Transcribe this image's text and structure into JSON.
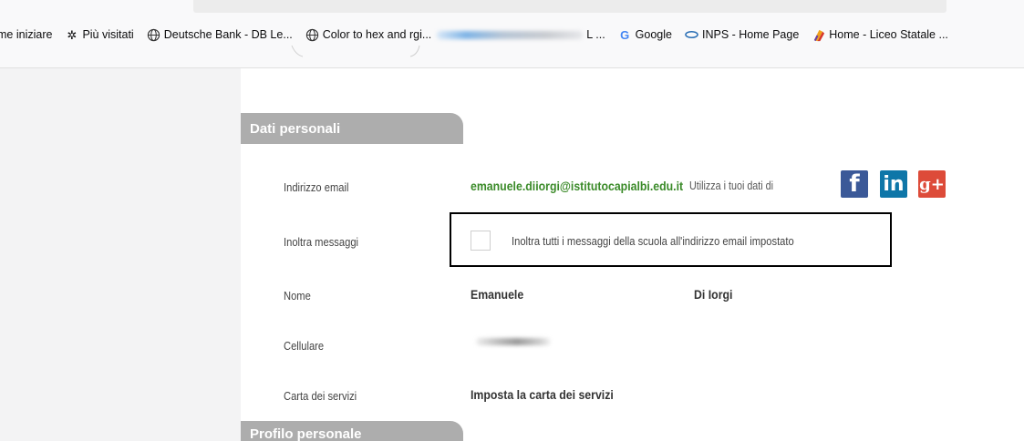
{
  "bookmarks": {
    "items": [
      {
        "label": "me iniziare",
        "icon": ""
      },
      {
        "label": "Più visitati",
        "icon": "gear-icon"
      },
      {
        "label": "Deutsche Bank - DB Le...",
        "icon": "globe-icon"
      },
      {
        "label": "Color to hex and rgi...",
        "icon": "globe-icon"
      },
      {
        "label": "L ...",
        "icon": "blurred-favicon"
      },
      {
        "label": "Google",
        "icon": "google-icon"
      },
      {
        "label": "INPS - Home Page",
        "icon": "inps-icon"
      },
      {
        "label": "Home - Liceo Statale ...",
        "icon": "liceo-icon"
      }
    ]
  },
  "sections": {
    "personal": {
      "title": "Dati personali"
    },
    "profile": {
      "title": "Profilo personale"
    }
  },
  "rows": {
    "email": {
      "label": "Indirizzo email",
      "value": "emanuele.diiorgi@istitutocapialbi.edu.it",
      "note": "Utilizza i tuoi dati di"
    },
    "forward": {
      "label": "Inoltra messaggi",
      "checkbox_text": "Inoltra tutti i messaggi della scuola all'indirizzo email impostato",
      "checked": false
    },
    "name": {
      "label": "Nome",
      "first": "Emanuele",
      "last": "Di Iorgi"
    },
    "phone": {
      "label": "Cellulare"
    },
    "services": {
      "label": "Carta dei servizi",
      "value": "Imposta la carta dei servizi"
    }
  },
  "social": {
    "facebook": {
      "glyph": "f",
      "color": "#3b5998"
    },
    "linkedin": {
      "glyph": "in",
      "color": "#0e76a8"
    },
    "googleplus": {
      "glyph": "g+",
      "color": "#dd4b39"
    }
  },
  "colors": {
    "email_value": "#3a8a28",
    "section_header_bg": "#adadad",
    "sidebar_bg": "#f3f3f4"
  }
}
